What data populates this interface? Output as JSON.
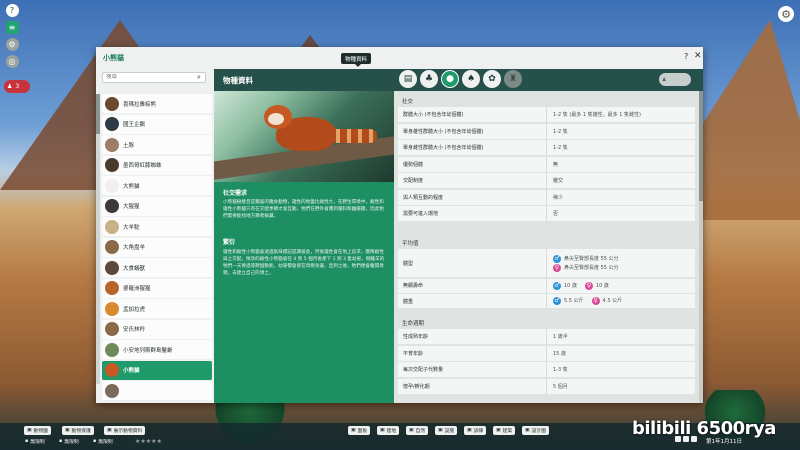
{
  "window": {
    "title": "小熊貓"
  },
  "search": {
    "placeholder": "搜尋"
  },
  "species_list": [
    {
      "name": "喜瑪拉雅棕熊",
      "color": "#6b4a2e"
    },
    {
      "name": "國王企鵝",
      "color": "#2c3b45"
    },
    {
      "name": "土豚",
      "color": "#9d7e62"
    },
    {
      "name": "墨西哥紅膝蜘蛛",
      "color": "#4a3a2a"
    },
    {
      "name": "大熊貓",
      "color": "#f0f0f0"
    },
    {
      "name": "大猩猩",
      "color": "#3a3a3a"
    },
    {
      "name": "大羊駝",
      "color": "#c9b28a"
    },
    {
      "name": "大角盘羊",
      "color": "#8a6a48"
    },
    {
      "name": "大食蟻獸",
      "color": "#5b4a3c"
    },
    {
      "name": "婆羅洲猩猩",
      "color": "#b8652c"
    },
    {
      "name": "孟加拉虎",
      "color": "#d9892e"
    },
    {
      "name": "安氏林羚",
      "color": "#8b6a4a"
    },
    {
      "name": "小安地列斯群島鬣蜥",
      "color": "#6e8a5a"
    },
    {
      "name": "小熊貓",
      "color": "#c65a22",
      "selected": true
    },
    {
      "name": "",
      "color": "#7a6a5a"
    }
  ],
  "detail": {
    "title": "物種資料",
    "tooltip": "物種資料",
    "tabs": [
      {
        "icon": "document-icon",
        "glyph": "▤"
      },
      {
        "icon": "habitat-icon",
        "glyph": "♣"
      },
      {
        "icon": "enrichment-icon",
        "glyph": "●"
      },
      {
        "icon": "food-icon",
        "glyph": "♠"
      },
      {
        "icon": "paw-icon",
        "glyph": "✿"
      },
      {
        "icon": "award-icon",
        "glyph": "♜"
      }
    ]
  },
  "info": {
    "social_title": "社交需求",
    "social_text": "小熊貓樹棲且是獨居的雜食動物，雄性的地盤比雌性大，在野生環境中，雌性和雄性小熊貓只有在交配季節才會互動。牠們在野外會遭到貓科和鼬屬獵，因此牠們需要能找地方攀爬躲藏。",
    "breeding_title": "繁衍",
    "breeding_text": "雄性和雌性小熊貓會透過氣味標記認識彼此，然後雄性會在地上追求，團隊雌性與之交配。懷孕的雌性小熊貓會在 4 到 5 個月後產下 1 到 3 隻幼崽，剛離羊的牠們一天要過等餵個動能，幼崽都會留在母親身邊，直到之後，牠們便會離開母親，去建立自己的領土。"
  },
  "stats": {
    "social": {
      "header": "社交",
      "rows": [
        {
          "label": "群體大小 (不包含年幼個體)",
          "value": "1-2 隻 (最多 1 隻雄性，最多 1 隻雌性)"
        },
        {
          "label": "單身雄性群體大小 (不包含年幼個體)",
          "value": "1-2 隻"
        },
        {
          "label": "單身雌性群體大小 (不包含年幼個體)",
          "value": "1-2 隻"
        },
        {
          "label": "優勢個體",
          "value": "無"
        },
        {
          "label": "交配制度",
          "value": "雜交"
        },
        {
          "label": "與人類互動的程度",
          "value": "稀少"
        },
        {
          "label": "需要可進入環地",
          "value": "否"
        }
      ]
    },
    "averages": {
      "header": "平均值",
      "body_label": "體型",
      "body_male": "鼻尖至臀部長度 55 公分",
      "body_female": "鼻尖至臀部長度 55 公分",
      "lifespan_label": "無顯壽命",
      "lifespan_male": "10 歲",
      "lifespan_female": "10 歲",
      "weight_label": "體重",
      "weight_male": "5.5 公斤",
      "weight_female": "4.5 公斤"
    },
    "lifecycle": {
      "header": "生命週期",
      "rows": [
        {
          "label": "性成熟年齡",
          "value": "1 歲半"
        },
        {
          "label": "不育年齡",
          "value": "15 歲"
        },
        {
          "label": "每次交配子代數量",
          "value": "1-3 隻"
        },
        {
          "label": "懷孕/孵化期",
          "value": "5 個月"
        }
      ]
    }
  },
  "bottom": {
    "animals_btn": "動物園",
    "habitat_btn": "動物保護",
    "exhibit_btn": "展示動物資料",
    "unlimited_1": "無限制",
    "unlimited_2": "無限制",
    "unlimited_3": "無限制",
    "tools": [
      "面板",
      "建地",
      "自然",
      "設施",
      "訓練",
      "建築",
      "設計圖"
    ],
    "date": "第1年1月11日",
    "watermark": "bilibili 6500rya",
    "alert_count": "3"
  },
  "colors": {
    "accent": "#1f9a6b",
    "card": "#1e8e63",
    "header": "#26504a",
    "male": "#2a8fd6",
    "female": "#d94a9a"
  }
}
